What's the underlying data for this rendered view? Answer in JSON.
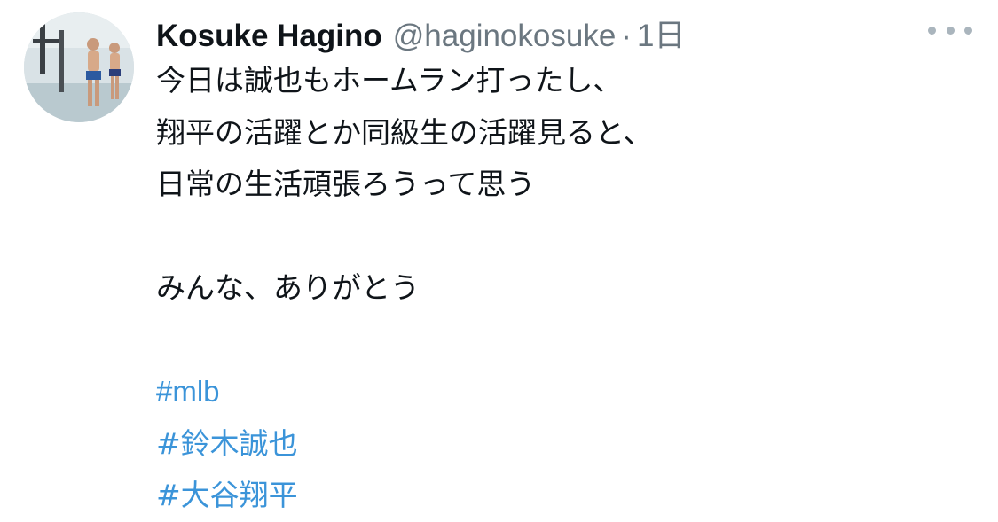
{
  "tweet": {
    "display_name": "Kosuke Hagino",
    "handle": "@haginokosuke",
    "separator": "·",
    "timestamp": "1日",
    "more_icon": "more-horizontal-icon",
    "text_lines": [
      "今日は誠也もホームラン打ったし、",
      "翔平の活躍とか同級生の活躍見ると、",
      "日常の生活頑張ろうって思う"
    ],
    "closing_line": "みんな、ありがとう",
    "hashtags": [
      "#mlb",
      "#鈴木誠也",
      "#大谷翔平"
    ]
  },
  "colors": {
    "text": "#0f1419",
    "secondary": "#6b7780",
    "link": "#3b94d9",
    "background": "#ffffff"
  }
}
